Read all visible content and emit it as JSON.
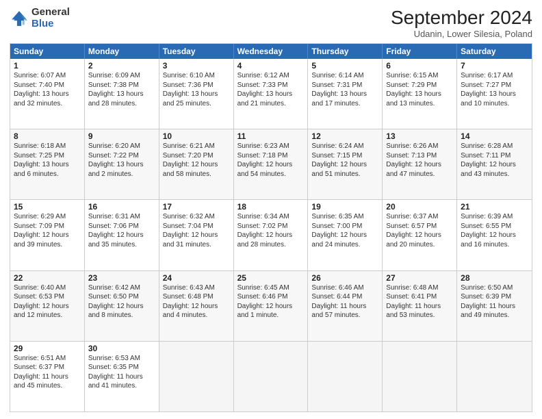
{
  "header": {
    "logo": {
      "general": "General",
      "blue": "Blue"
    },
    "title": "September 2024",
    "subtitle": "Udanin, Lower Silesia, Poland"
  },
  "weekdays": [
    "Sunday",
    "Monday",
    "Tuesday",
    "Wednesday",
    "Thursday",
    "Friday",
    "Saturday"
  ],
  "rows": [
    [
      {
        "day": "",
        "info": "",
        "empty": true
      },
      {
        "day": "2",
        "info": "Sunrise: 6:09 AM\nSunset: 7:38 PM\nDaylight: 13 hours\nand 28 minutes."
      },
      {
        "day": "3",
        "info": "Sunrise: 6:10 AM\nSunset: 7:36 PM\nDaylight: 13 hours\nand 25 minutes."
      },
      {
        "day": "4",
        "info": "Sunrise: 6:12 AM\nSunset: 7:33 PM\nDaylight: 13 hours\nand 21 minutes."
      },
      {
        "day": "5",
        "info": "Sunrise: 6:14 AM\nSunset: 7:31 PM\nDaylight: 13 hours\nand 17 minutes."
      },
      {
        "day": "6",
        "info": "Sunrise: 6:15 AM\nSunset: 7:29 PM\nDaylight: 13 hours\nand 13 minutes."
      },
      {
        "day": "7",
        "info": "Sunrise: 6:17 AM\nSunset: 7:27 PM\nDaylight: 13 hours\nand 10 minutes."
      }
    ],
    [
      {
        "day": "8",
        "info": "Sunrise: 6:18 AM\nSunset: 7:25 PM\nDaylight: 13 hours\nand 6 minutes."
      },
      {
        "day": "9",
        "info": "Sunrise: 6:20 AM\nSunset: 7:22 PM\nDaylight: 13 hours\nand 2 minutes."
      },
      {
        "day": "10",
        "info": "Sunrise: 6:21 AM\nSunset: 7:20 PM\nDaylight: 12 hours\nand 58 minutes."
      },
      {
        "day": "11",
        "info": "Sunrise: 6:23 AM\nSunset: 7:18 PM\nDaylight: 12 hours\nand 54 minutes."
      },
      {
        "day": "12",
        "info": "Sunrise: 6:24 AM\nSunset: 7:15 PM\nDaylight: 12 hours\nand 51 minutes."
      },
      {
        "day": "13",
        "info": "Sunrise: 6:26 AM\nSunset: 7:13 PM\nDaylight: 12 hours\nand 47 minutes."
      },
      {
        "day": "14",
        "info": "Sunrise: 6:28 AM\nSunset: 7:11 PM\nDaylight: 12 hours\nand 43 minutes."
      }
    ],
    [
      {
        "day": "15",
        "info": "Sunrise: 6:29 AM\nSunset: 7:09 PM\nDaylight: 12 hours\nand 39 minutes."
      },
      {
        "day": "16",
        "info": "Sunrise: 6:31 AM\nSunset: 7:06 PM\nDaylight: 12 hours\nand 35 minutes."
      },
      {
        "day": "17",
        "info": "Sunrise: 6:32 AM\nSunset: 7:04 PM\nDaylight: 12 hours\nand 31 minutes."
      },
      {
        "day": "18",
        "info": "Sunrise: 6:34 AM\nSunset: 7:02 PM\nDaylight: 12 hours\nand 28 minutes."
      },
      {
        "day": "19",
        "info": "Sunrise: 6:35 AM\nSunset: 7:00 PM\nDaylight: 12 hours\nand 24 minutes."
      },
      {
        "day": "20",
        "info": "Sunrise: 6:37 AM\nSunset: 6:57 PM\nDaylight: 12 hours\nand 20 minutes."
      },
      {
        "day": "21",
        "info": "Sunrise: 6:39 AM\nSunset: 6:55 PM\nDaylight: 12 hours\nand 16 minutes."
      }
    ],
    [
      {
        "day": "22",
        "info": "Sunrise: 6:40 AM\nSunset: 6:53 PM\nDaylight: 12 hours\nand 12 minutes."
      },
      {
        "day": "23",
        "info": "Sunrise: 6:42 AM\nSunset: 6:50 PM\nDaylight: 12 hours\nand 8 minutes."
      },
      {
        "day": "24",
        "info": "Sunrise: 6:43 AM\nSunset: 6:48 PM\nDaylight: 12 hours\nand 4 minutes."
      },
      {
        "day": "25",
        "info": "Sunrise: 6:45 AM\nSunset: 6:46 PM\nDaylight: 12 hours\nand 1 minute."
      },
      {
        "day": "26",
        "info": "Sunrise: 6:46 AM\nSunset: 6:44 PM\nDaylight: 11 hours\nand 57 minutes."
      },
      {
        "day": "27",
        "info": "Sunrise: 6:48 AM\nSunset: 6:41 PM\nDaylight: 11 hours\nand 53 minutes."
      },
      {
        "day": "28",
        "info": "Sunrise: 6:50 AM\nSunset: 6:39 PM\nDaylight: 11 hours\nand 49 minutes."
      }
    ],
    [
      {
        "day": "29",
        "info": "Sunrise: 6:51 AM\nSunset: 6:37 PM\nDaylight: 11 hours\nand 45 minutes."
      },
      {
        "day": "30",
        "info": "Sunrise: 6:53 AM\nSunset: 6:35 PM\nDaylight: 11 hours\nand 41 minutes."
      },
      {
        "day": "",
        "info": "",
        "empty": true
      },
      {
        "day": "",
        "info": "",
        "empty": true
      },
      {
        "day": "",
        "info": "",
        "empty": true
      },
      {
        "day": "",
        "info": "",
        "empty": true
      },
      {
        "day": "",
        "info": "",
        "empty": true
      }
    ]
  ],
  "row0_day1": {
    "day": "1",
    "info": "Sunrise: 6:07 AM\nSunset: 7:40 PM\nDaylight: 13 hours\nand 32 minutes."
  }
}
